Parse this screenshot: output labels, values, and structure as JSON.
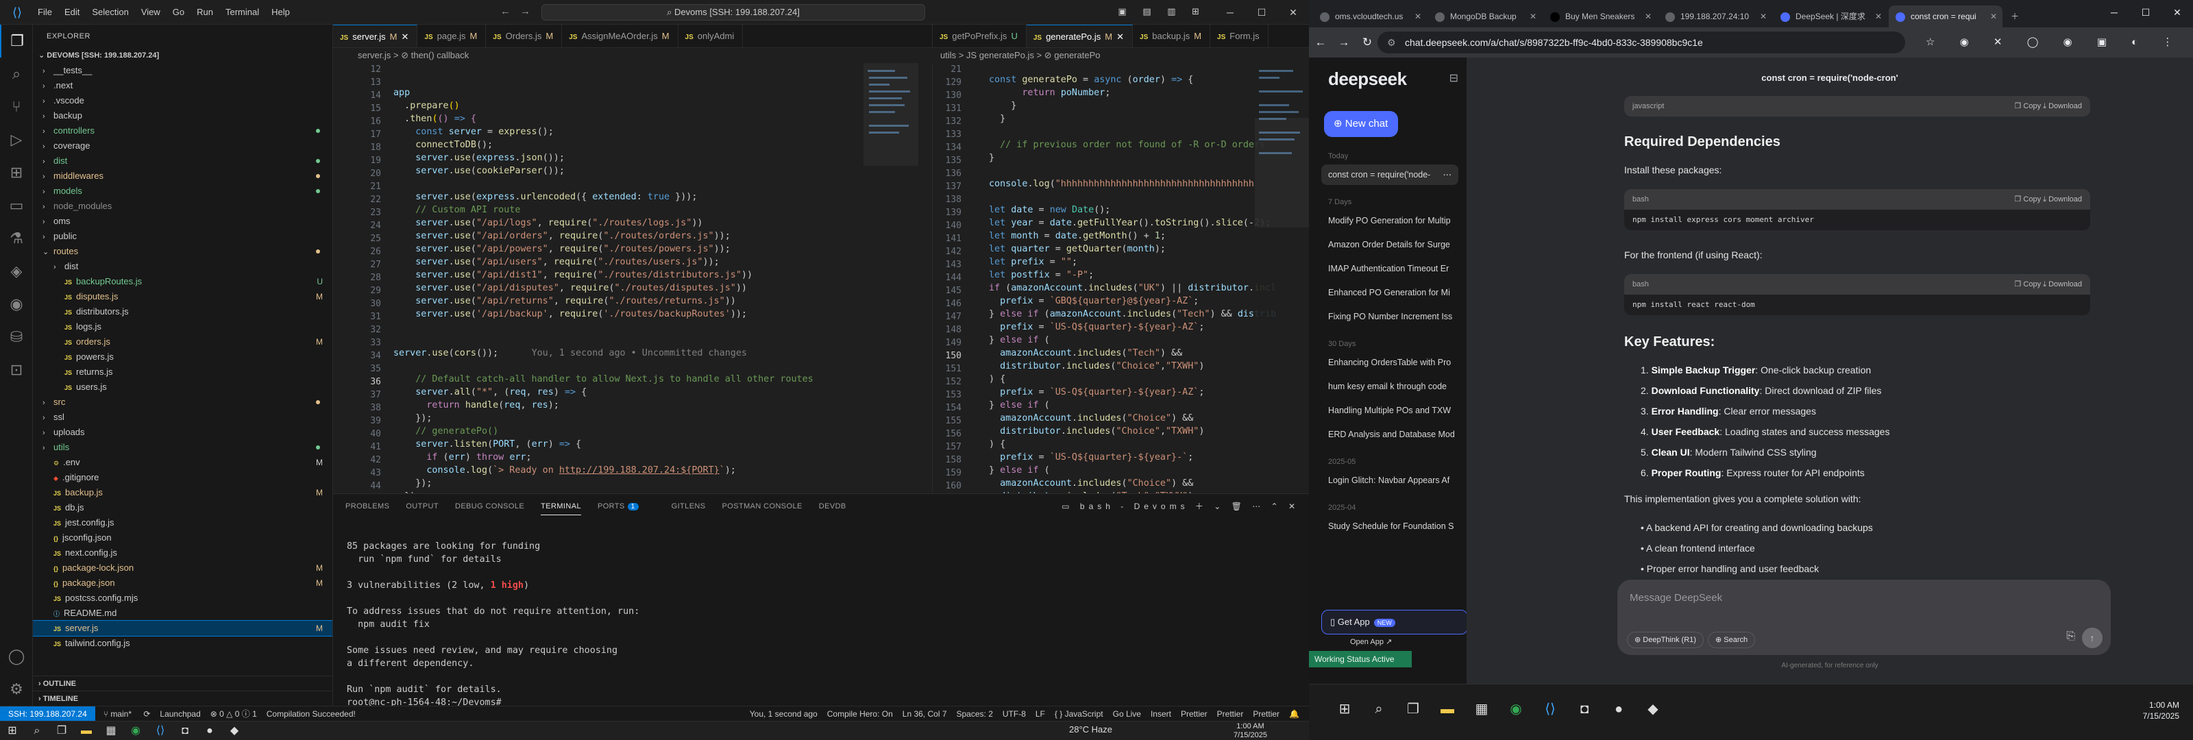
{
  "vscode": {
    "title": "Devoms [SSH: 199.188.207.24]",
    "menu": [
      "File",
      "Edit",
      "Selection",
      "View",
      "Go",
      "Run",
      "Terminal",
      "Help"
    ],
    "explorer_title": "EXPLORER",
    "root": "DEVOMS [SSH: 199.188.207.24]",
    "tree": [
      {
        "name": "__tests__",
        "depth": 0,
        "type": "folder",
        "color": "#cccccc"
      },
      {
        "name": ".next",
        "depth": 0,
        "type": "folder",
        "color": "#cccccc"
      },
      {
        "name": ".vscode",
        "depth": 0,
        "type": "folder",
        "color": "#cccccc"
      },
      {
        "name": "backup",
        "depth": 0,
        "type": "folder",
        "color": "#cccccc"
      },
      {
        "name": "controllers",
        "depth": 0,
        "type": "folder",
        "color": "#73c991",
        "dot": "#73c991"
      },
      {
        "name": "coverage",
        "depth": 0,
        "type": "folder",
        "color": "#cccccc"
      },
      {
        "name": "dist",
        "depth": 0,
        "type": "folder",
        "color": "#73c991",
        "dot": "#73c991"
      },
      {
        "name": "middlewares",
        "depth": 0,
        "type": "folder",
        "color": "#e2c08d",
        "dot": "#e2c08d"
      },
      {
        "name": "models",
        "depth": 0,
        "type": "folder",
        "color": "#73c991",
        "dot": "#73c991"
      },
      {
        "name": "node_modules",
        "depth": 0,
        "type": "folder",
        "color": "#8c8c8c"
      },
      {
        "name": "oms",
        "depth": 0,
        "type": "folder",
        "color": "#cccccc"
      },
      {
        "name": "public",
        "depth": 0,
        "type": "folder",
        "color": "#cccccc"
      },
      {
        "name": "routes",
        "depth": 0,
        "type": "folder-open",
        "color": "#e2c08d",
        "dot": "#e2c08d"
      },
      {
        "name": "dist",
        "depth": 1,
        "type": "folder",
        "color": "#cccccc"
      },
      {
        "name": "backupRoutes.js",
        "depth": 1,
        "type": "js",
        "color": "#73c991",
        "badge": "U"
      },
      {
        "name": "disputes.js",
        "depth": 1,
        "type": "js",
        "color": "#e2c08d",
        "badge": "M"
      },
      {
        "name": "distributors.js",
        "depth": 1,
        "type": "js",
        "color": "#cccccc"
      },
      {
        "name": "logs.js",
        "depth": 1,
        "type": "js",
        "color": "#cccccc"
      },
      {
        "name": "orders.js",
        "depth": 1,
        "type": "js",
        "color": "#e2c08d",
        "badge": "M"
      },
      {
        "name": "powers.js",
        "depth": 1,
        "type": "js",
        "color": "#cccccc"
      },
      {
        "name": "returns.js",
        "depth": 1,
        "type": "js",
        "color": "#cccccc"
      },
      {
        "name": "users.js",
        "depth": 1,
        "type": "js",
        "color": "#cccccc"
      },
      {
        "name": "src",
        "depth": 0,
        "type": "folder",
        "color": "#e2c08d",
        "dot": "#e2c08d"
      },
      {
        "name": "ssl",
        "depth": 0,
        "type": "folder",
        "color": "#cccccc"
      },
      {
        "name": "uploads",
        "depth": 0,
        "type": "folder",
        "color": "#cccccc"
      },
      {
        "name": "utils",
        "depth": 0,
        "type": "folder",
        "color": "#73c991",
        "dot": "#73c991"
      },
      {
        "name": ".env",
        "depth": 0,
        "type": "env",
        "color": "#cccccc",
        "badge": "M"
      },
      {
        "name": ".gitignore",
        "depth": 0,
        "type": "git",
        "color": "#cccccc"
      },
      {
        "name": "backup.js",
        "depth": 0,
        "type": "js",
        "color": "#e2c08d",
        "badge": "M"
      },
      {
        "name": "db.js",
        "depth": 0,
        "type": "js",
        "color": "#cccccc"
      },
      {
        "name": "jest.config.js",
        "depth": 0,
        "type": "js",
        "color": "#cccccc"
      },
      {
        "name": "jsconfig.json",
        "depth": 0,
        "type": "json",
        "color": "#cccccc"
      },
      {
        "name": "next.config.js",
        "depth": 0,
        "type": "js",
        "color": "#cccccc"
      },
      {
        "name": "package-lock.json",
        "depth": 0,
        "type": "json",
        "color": "#e2c08d",
        "badge": "M"
      },
      {
        "name": "package.json",
        "depth": 0,
        "type": "json",
        "color": "#e2c08d",
        "badge": "M"
      },
      {
        "name": "postcss.config.mjs",
        "depth": 0,
        "type": "js",
        "color": "#cccccc"
      },
      {
        "name": "README.md",
        "depth": 0,
        "type": "md",
        "color": "#cccccc"
      },
      {
        "name": "server.js",
        "depth": 0,
        "type": "js",
        "color": "#e2c08d",
        "badge": "M",
        "selected": true
      },
      {
        "name": "tailwind.config.js",
        "depth": 0,
        "type": "js",
        "color": "#cccccc"
      }
    ],
    "outline": "OUTLINE",
    "timeline": "TIMELINE",
    "left_tabs": [
      {
        "label": "server.js",
        "mod": "M",
        "active": true,
        "close": true
      },
      {
        "label": "page.js",
        "mod": "M"
      },
      {
        "label": "Orders.js",
        "mod": "M"
      },
      {
        "label": "AssignMeAOrder.js",
        "mod": "M"
      },
      {
        "label": "onlyAdmi",
        "mod": ""
      }
    ],
    "left_crumb": "server.js > ⊘ then() callback",
    "right_tabs": [
      {
        "label": "getPoPrefix.js",
        "mod": "U"
      },
      {
        "label": "generatePo.js",
        "mod": "M",
        "active": true
      },
      {
        "label": "backup.js",
        "mod": "M"
      },
      {
        "label": "Form.js",
        "mod": ""
      }
    ],
    "right_crumb": "utils > JS generatePo.js > ⊘ generatePo",
    "left_lines": [
      12,
      13,
      14,
      15,
      16,
      17,
      18,
      19,
      20,
      21,
      22,
      23,
      24,
      25,
      26,
      27,
      28,
      29,
      30,
      31,
      32,
      33,
      34,
      35,
      36,
      37,
      38,
      39,
      40,
      41,
      42,
      43,
      44,
      45,
      46
    ],
    "right_lines": [
      21,
      129,
      130,
      131,
      132,
      133,
      134,
      135,
      136,
      137,
      138,
      139,
      140,
      141,
      142,
      143,
      144,
      145,
      146,
      147,
      148,
      149,
      150,
      151,
      152,
      153,
      154,
      155,
      156,
      157,
      158,
      159,
      160
    ],
    "blame": "You, 1 second ago • Uncommitted changes",
    "panel_tabs": [
      "PROBLEMS",
      "OUTPUT",
      "DEBUG CONSOLE",
      "TERMINAL",
      "PORTS",
      "GITLENS",
      "POSTMAN CONSOLE",
      "DEVDB"
    ],
    "ports_count": "1",
    "terminal_label": "bash - Devoms",
    "terminal": [
      "",
      "85 packages are looking for funding",
      "  run `npm fund` for details",
      "",
      "3 vulnerabilities (2 low, 1 high)",
      "",
      "To address issues that do not require attention, run:",
      "  npm audit fix",
      "",
      "Some issues need review, and may require choosing",
      "a different dependency.",
      "",
      "Run `npm audit` for details.",
      "root@nc-ph-1564-48:~/Devoms# "
    ],
    "status": {
      "remote": "SSH: 199.188.207.24",
      "branch": "main*",
      "launchpad": "Launchpad",
      "errors": "⊗ 0 △ 0 ⓘ 1",
      "build": "Compilation Succeeded!",
      "blame": "You, 1 second ago",
      "compile": "Compile Hero: On",
      "pos": "Ln 36, Col 7",
      "spaces": "Spaces: 2",
      "enc": "UTF-8",
      "eol": "LF",
      "lang": "{ } JavaScript",
      "golive": "Go Live",
      "insert": "Insert",
      "prettier": "Prettier",
      "prettier2": "Prettier",
      "prettier3": "Prettier"
    },
    "weather": "28°C  Haze",
    "clock_time": "1:00 AM",
    "clock_date": "7/15/2025"
  },
  "browser": {
    "tabs": [
      {
        "label": "oms.vcloudtech.us",
        "color": "#5f6368"
      },
      {
        "label": "MongoDB Backup",
        "color": "#5f6368"
      },
      {
        "label": "Buy Men Sneakers",
        "color": "#000000"
      },
      {
        "label": "199.188.207.24:10",
        "color": "#5f6368"
      },
      {
        "label": "DeepSeek | 深度求",
        "color": "#4d6bfe"
      },
      {
        "label": "const cron = requi",
        "color": "#4d6bfe",
        "active": true
      }
    ],
    "url": "chat.deepseek.com/a/chat/s/8987322b-ff9c-4bd0-833c-389908bc9c1e",
    "deepseek": {
      "logo": "deepseek",
      "new_chat": "New chat",
      "sections": [
        {
          "label": "Today",
          "items": [
            {
              "t": "const cron = require('node-",
              "sel": true
            }
          ]
        },
        {
          "label": "7 Days",
          "items": [
            {
              "t": "Modify PO Generation for Multip"
            },
            {
              "t": "Amazon Order Details for Surge"
            },
            {
              "t": "IMAP Authentication Timeout Er"
            },
            {
              "t": "Enhanced PO Generation for Mi"
            },
            {
              "t": "Fixing PO Number Increment Iss"
            }
          ]
        },
        {
          "label": "30 Days",
          "items": [
            {
              "t": "Enhancing OrdersTable with Pro"
            },
            {
              "t": "hum kesy email k through code"
            },
            {
              "t": "Handling Multiple POs and TXW"
            },
            {
              "t": "ERD Analysis and Database Mod"
            }
          ]
        },
        {
          "label": "2025-05",
          "items": [
            {
              "t": "Login Glitch: Navbar Appears Af"
            }
          ]
        },
        {
          "label": "2025-04",
          "items": [
            {
              "t": "Study Schedule for Foundation S"
            }
          ]
        }
      ],
      "get_app": "Get App",
      "get_app_badge": "NEW",
      "open_app": "Open App ↗",
      "working": "Working Status Active",
      "header": "const cron = require('node-cron'",
      "copy": "Copy",
      "download": "Download",
      "blocks": [
        {
          "lang": "javascript",
          "code": ""
        },
        {
          "lang": "bash",
          "code": "npm install express cors moment archiver"
        },
        {
          "lang": "bash",
          "code": "npm install react react-dom"
        }
      ],
      "h_required": "Required Dependencies",
      "install_text": "Install these packages:",
      "frontend_text": "For the frontend (if using React):",
      "h_features": "Key Features:",
      "features": [
        {
          "b": "Simple Backup Trigger",
          "t": ": One-click backup creation"
        },
        {
          "b": "Download Functionality",
          "t": ": Direct download of ZIP files"
        },
        {
          "b": "Error Handling",
          "t": ": Clear error messages"
        },
        {
          "b": "User Feedback",
          "t": ": Loading states and success messages"
        },
        {
          "b": "Clean UI",
          "t": ": Modern Tailwind CSS styling"
        },
        {
          "b": "Proper Routing",
          "t": ": Express router for API endpoints"
        }
      ],
      "impl_text": "This implementation gives you a complete solution with:",
      "bullets": [
        "A backend API for creating and downloading backups",
        "A clean frontend interface",
        "Proper error handling and user feedback",
        "Simple one-click operations"
      ],
      "placeholder": "Message DeepSeek",
      "deepthink": "DeepThink (R1)",
      "search": "Search",
      "footer": "AI-generated, for reference only"
    },
    "clock_time": "1:00 AM",
    "clock_date": "7/15/2025"
  }
}
